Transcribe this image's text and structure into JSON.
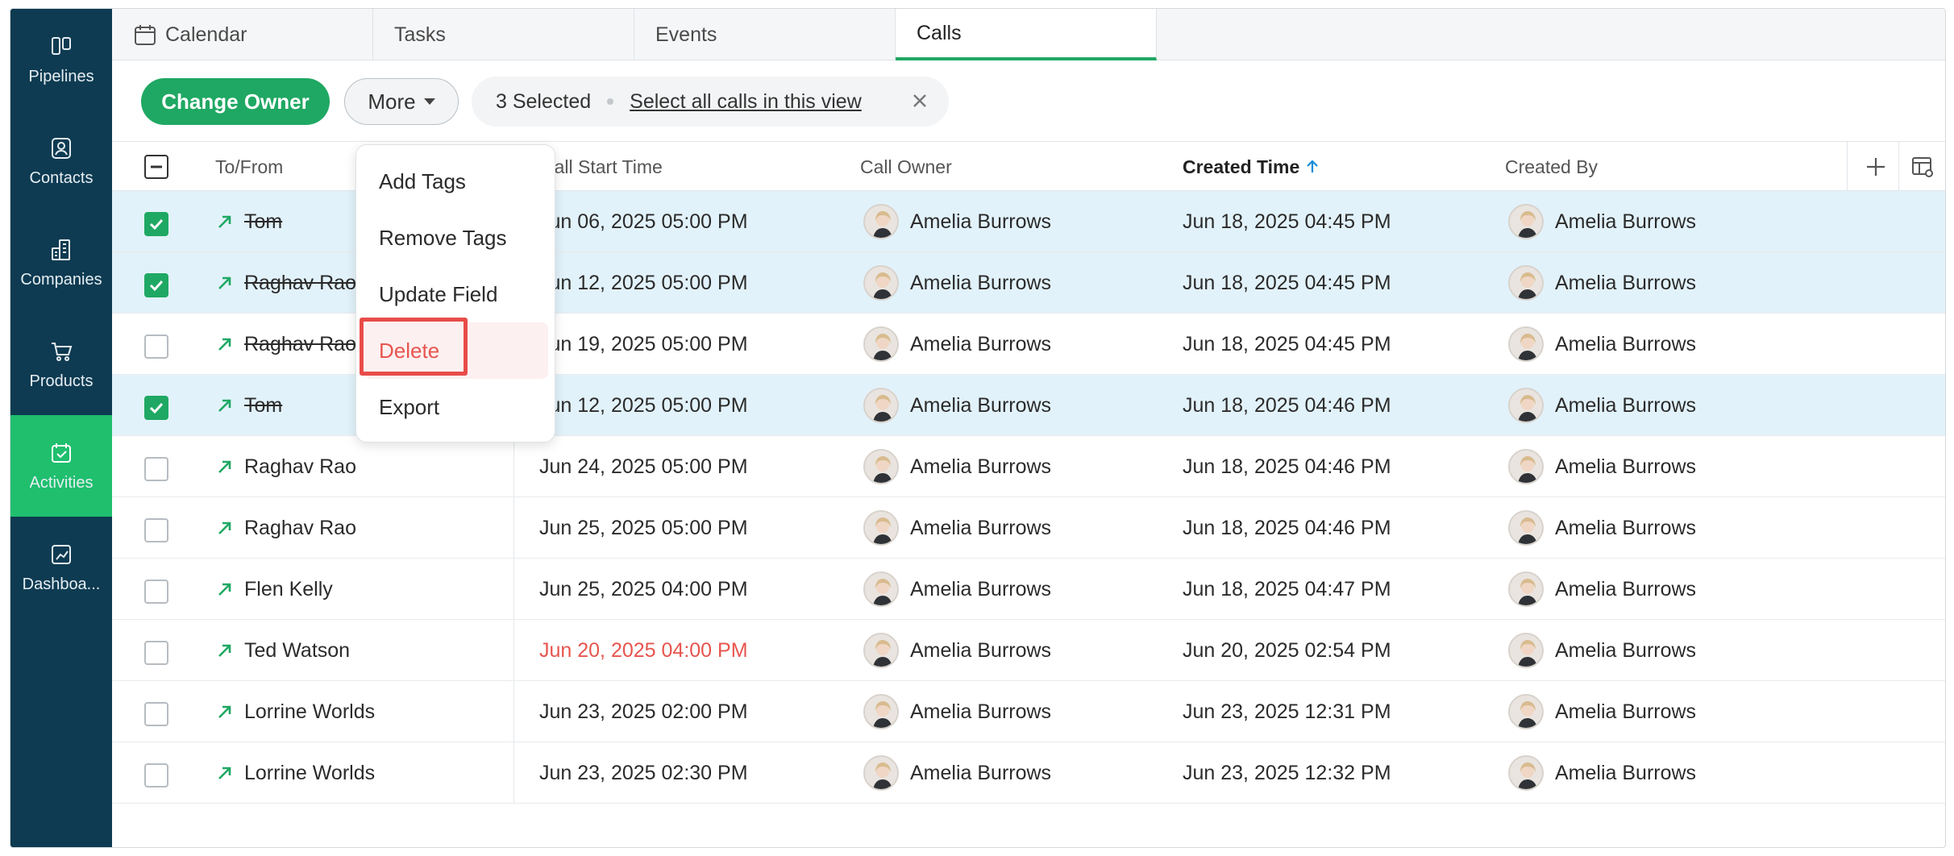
{
  "sidebar": {
    "items": [
      {
        "label": "Pipelines",
        "icon": "pipelines-icon",
        "active": false
      },
      {
        "label": "Contacts",
        "icon": "contacts-icon",
        "active": false
      },
      {
        "label": "Companies",
        "icon": "companies-icon",
        "active": false
      },
      {
        "label": "Products",
        "icon": "products-icon",
        "active": false
      },
      {
        "label": "Activities",
        "icon": "activities-icon",
        "active": true
      },
      {
        "label": "Dashboa...",
        "icon": "dashboards-icon",
        "active": false
      }
    ]
  },
  "tabs": [
    {
      "label": "Calendar",
      "icon": "calendar-icon",
      "active": false
    },
    {
      "label": "Tasks",
      "active": false
    },
    {
      "label": "Events",
      "active": false
    },
    {
      "label": "Calls",
      "active": true
    }
  ],
  "toolbar": {
    "change_owner": "Change Owner",
    "more": "More",
    "selected_count": "3 Selected",
    "select_all": "Select all calls in this view"
  },
  "menu": {
    "items": [
      "Add Tags",
      "Remove Tags",
      "Update Field",
      "Delete",
      "Export"
    ]
  },
  "table": {
    "headers": {
      "to_from": "To/From",
      "call_start_time": "Call Start Time",
      "call_owner": "Call Owner",
      "created_time": "Created Time",
      "created_by": "Created By"
    },
    "rows": [
      {
        "to_from": "Tom",
        "start": "Jun 06, 2025 05:00 PM",
        "owner": "Amelia Burrows",
        "created": "Jun 18, 2025 04:45 PM",
        "created_by": "Amelia Burrows",
        "checked": true,
        "strike": true,
        "overdue": false
      },
      {
        "to_from": "Raghav Rao",
        "start": "Jun 12, 2025 05:00 PM",
        "owner": "Amelia Burrows",
        "created": "Jun 18, 2025 04:45 PM",
        "created_by": "Amelia Burrows",
        "checked": true,
        "strike": true,
        "overdue": false
      },
      {
        "to_from": "Raghav Rao",
        "start": "Jun 19, 2025 05:00 PM",
        "owner": "Amelia Burrows",
        "created": "Jun 18, 2025 04:45 PM",
        "created_by": "Amelia Burrows",
        "checked": false,
        "strike": true,
        "overdue": false
      },
      {
        "to_from": "Tom",
        "start": "Jun 12, 2025 05:00 PM",
        "owner": "Amelia Burrows",
        "created": "Jun 18, 2025 04:46 PM",
        "created_by": "Amelia Burrows",
        "checked": true,
        "strike": true,
        "overdue": false
      },
      {
        "to_from": "Raghav Rao",
        "start": "Jun 24, 2025 05:00 PM",
        "owner": "Amelia Burrows",
        "created": "Jun 18, 2025 04:46 PM",
        "created_by": "Amelia Burrows",
        "checked": false,
        "strike": false,
        "overdue": false
      },
      {
        "to_from": "Raghav Rao",
        "start": "Jun 25, 2025 05:00 PM",
        "owner": "Amelia Burrows",
        "created": "Jun 18, 2025 04:46 PM",
        "created_by": "Amelia Burrows",
        "checked": false,
        "strike": false,
        "overdue": false
      },
      {
        "to_from": "Flen Kelly",
        "start": "Jun 25, 2025 04:00 PM",
        "owner": "Amelia Burrows",
        "created": "Jun 18, 2025 04:47 PM",
        "created_by": "Amelia Burrows",
        "checked": false,
        "strike": false,
        "overdue": false
      },
      {
        "to_from": "Ted Watson",
        "start": "Jun 20, 2025 04:00 PM",
        "owner": "Amelia Burrows",
        "created": "Jun 20, 2025 02:54 PM",
        "created_by": "Amelia Burrows",
        "checked": false,
        "strike": false,
        "overdue": true
      },
      {
        "to_from": "Lorrine Worlds",
        "start": "Jun 23, 2025 02:00 PM",
        "owner": "Amelia Burrows",
        "created": "Jun 23, 2025 12:31 PM",
        "created_by": "Amelia Burrows",
        "checked": false,
        "strike": false,
        "overdue": false
      },
      {
        "to_from": "Lorrine Worlds",
        "start": "Jun 23, 2025 02:30 PM",
        "owner": "Amelia Burrows",
        "created": "Jun 23, 2025 12:32 PM",
        "created_by": "Amelia Burrows",
        "checked": false,
        "strike": false,
        "overdue": false
      }
    ]
  },
  "colors": {
    "sidebar_bg": "#0e3b52",
    "accent_green": "#1fa863",
    "active_nav": "#1fbf6e",
    "selected_row": "#e2f2fa",
    "overdue": "#e7554e",
    "danger": "#e8554f"
  }
}
